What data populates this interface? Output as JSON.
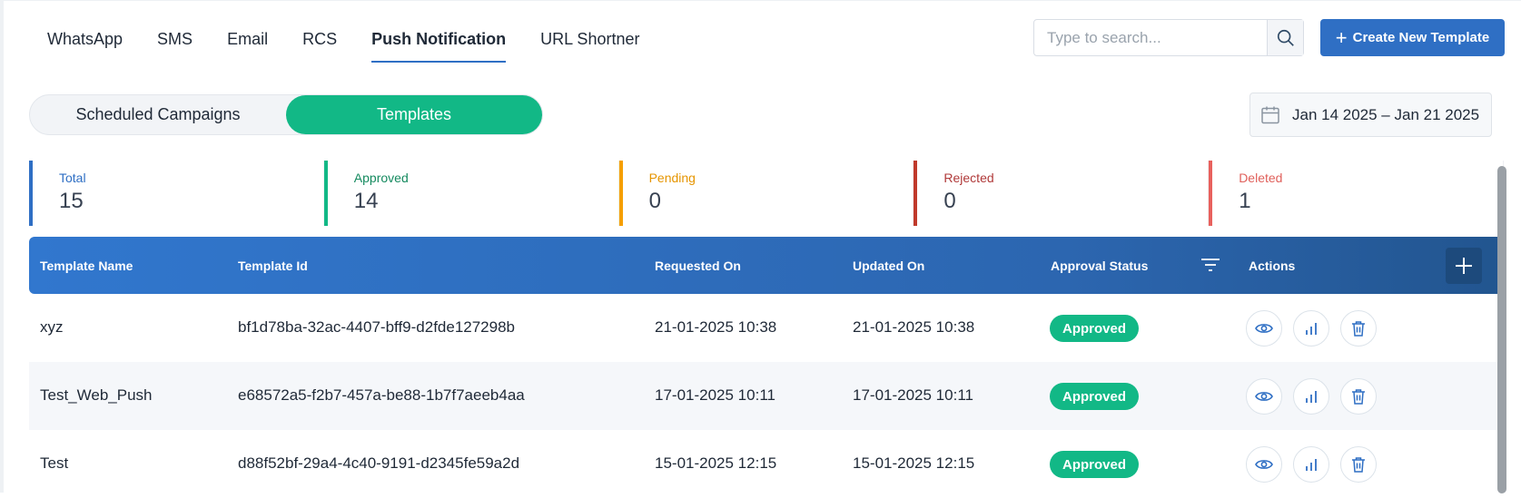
{
  "channel_tabs": [
    {
      "label": "WhatsApp",
      "active": false
    },
    {
      "label": "SMS",
      "active": false
    },
    {
      "label": "Email",
      "active": false
    },
    {
      "label": "RCS",
      "active": false
    },
    {
      "label": "Push Notification",
      "active": true
    },
    {
      "label": "URL Shortner",
      "active": false
    }
  ],
  "search": {
    "placeholder": "Type to search...",
    "value": ""
  },
  "create_button": {
    "label": "Create New Template"
  },
  "segments": [
    {
      "label": "Scheduled Campaigns",
      "active": false
    },
    {
      "label": "Templates",
      "active": true
    }
  ],
  "date_range": {
    "label": "Jan 14 2025 – Jan 21 2025"
  },
  "stats": [
    {
      "label": "Total",
      "value": "15",
      "color": "#2f6fc4"
    },
    {
      "label": "Approved",
      "value": "14",
      "color": "#12b886"
    },
    {
      "label": "Pending",
      "value": "0",
      "color": "#f59f00"
    },
    {
      "label": "Rejected",
      "value": "0",
      "color": "#c0392b"
    },
    {
      "label": "Deleted",
      "value": "1",
      "color": "#e8615d"
    }
  ],
  "table": {
    "columns": [
      "Template Name",
      "Template Id",
      "Requested On",
      "Updated On",
      "Approval Status",
      "Actions"
    ],
    "rows": [
      {
        "name": "xyz",
        "id": "bf1d78ba-32ac-4407-bff9-d2fde127298b",
        "requested": "21-01-2025 10:38",
        "updated": "21-01-2025 10:38",
        "status": "Approved"
      },
      {
        "name": "Test_Web_Push",
        "id": "e68572a5-f2b7-457a-be88-1b7f7aeeb4aa",
        "requested": "17-01-2025 10:11",
        "updated": "17-01-2025 10:11",
        "status": "Approved"
      },
      {
        "name": "Test",
        "id": "d88f52bf-29a4-4c40-9191-d2345fe59a2d",
        "requested": "15-01-2025 12:15",
        "updated": "15-01-2025 12:15",
        "status": "Approved"
      }
    ]
  },
  "icons": {
    "search": "search-icon",
    "plus": "plus-icon",
    "calendar": "calendar-icon",
    "filter": "filter-icon",
    "view": "eye-icon",
    "analytics": "bar-chart-icon",
    "delete": "trash-icon"
  },
  "colors": {
    "primary": "#2f6fc4",
    "success": "#12b886"
  }
}
